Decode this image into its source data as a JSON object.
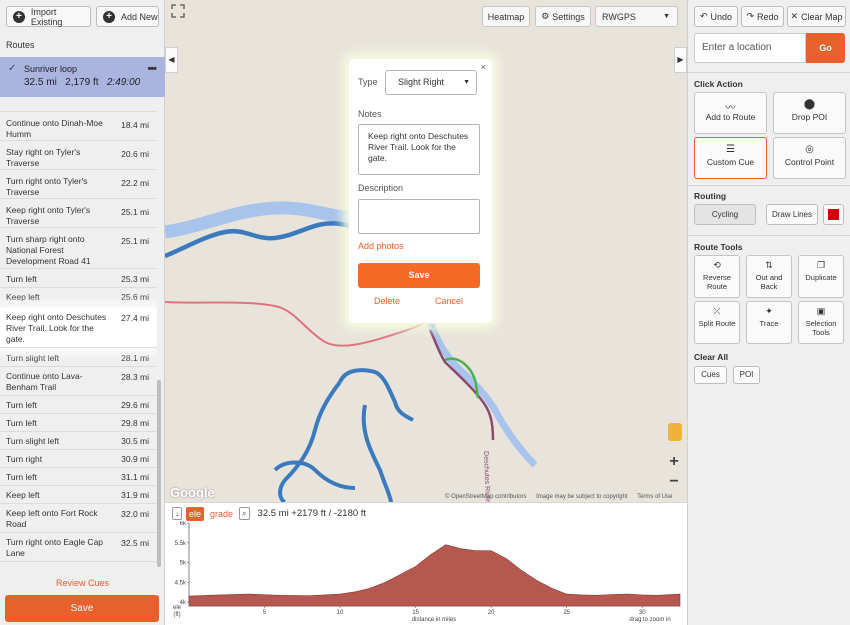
{
  "left_panel": {
    "import_label": "Import Existing",
    "add_new_label": "Add New",
    "routes_heading": "Routes",
    "route": {
      "name": "Sunriver loop",
      "distance": "32.5 mi",
      "elevation": "2,179 ft",
      "time": "2:49:00"
    },
    "cues": [
      {
        "text": "Continue onto Dinah-Moe Humm",
        "distance": "18.4 mi"
      },
      {
        "text": "Stay right on Tyler's Traverse",
        "distance": "20.6 mi"
      },
      {
        "text": "Turn right onto Tyler's Traverse",
        "distance": "22.2 mi"
      },
      {
        "text": "Keep right onto Tyler's Traverse",
        "distance": "25.1 mi"
      },
      {
        "text": "Turn sharp right onto National Forest Development Road 41",
        "distance": "25.1 mi"
      },
      {
        "text": "Turn left",
        "distance": "25.3 mi"
      },
      {
        "text": "Keep left",
        "distance": "25.6 mi"
      },
      {
        "text": "Keep right onto Deschutes River Trail. Look for the gate.",
        "distance": "27.4 mi"
      },
      {
        "text": "Turn slight left",
        "distance": "28.1 mi"
      },
      {
        "text": "Continue onto Lava-Benham Trail",
        "distance": "28.3 mi"
      },
      {
        "text": "Turn left",
        "distance": "29.6 mi"
      },
      {
        "text": "Turn left",
        "distance": "29.8 mi"
      },
      {
        "text": "Turn slight left",
        "distance": "30.5 mi"
      },
      {
        "text": "Turn right",
        "distance": "30.9 mi"
      },
      {
        "text": "Turn left",
        "distance": "31.1 mi"
      },
      {
        "text": "Keep left",
        "distance": "31.9 mi"
      },
      {
        "text": "Keep left onto Fort Rock Road",
        "distance": "32.0 mi"
      },
      {
        "text": "Turn right onto Eagle Cap Lane",
        "distance": "32.5 mi"
      }
    ],
    "review_cues_label": "Review Cues",
    "save_label": "Save"
  },
  "map": {
    "heatmap_label": "Heatmap",
    "settings_label": "Settings",
    "layer_label": "RWGPS",
    "google_label": "Google",
    "attribution": [
      "© OpenStreetMap contributors",
      "Image may be subject to copyright",
      "Terms of Use"
    ],
    "trail_label": "Deschutes River Trail",
    "zoom_in": "+",
    "zoom_out": "−"
  },
  "popup": {
    "type_label": "Type",
    "type_value": "Slight Right",
    "notes_label": "Notes",
    "notes_value": "Keep right onto Deschutes River Trail. Look for the gate.",
    "description_label": "Description",
    "description_value": "",
    "add_photos_label": "Add photos",
    "save_label": "Save",
    "delete_label": "Delete",
    "cancel_label": "Cancel",
    "close_glyph": "×"
  },
  "elevation": {
    "tab_ele": "ele",
    "tab_grade": "grade",
    "summary": "32.5 mi +2179 ft / -2180 ft",
    "y_ticks": [
      "6k",
      "5.5k",
      "5k",
      "4.5k",
      "4k"
    ],
    "y_unit_label": "ele (ft)",
    "x_ticks": [
      "5",
      "10",
      "15",
      "20",
      "25",
      "30"
    ],
    "x_label": "distance in miles",
    "hint": "drag to zoom in",
    "fill_color": "#b5584f"
  },
  "chart_data": {
    "type": "area",
    "xlabel": "distance in miles",
    "ylabel": "ele (ft)",
    "xlim": [
      0,
      32.5
    ],
    "ylim": [
      3900,
      6000
    ],
    "x": [
      0,
      2,
      4,
      6,
      8,
      10,
      11,
      12,
      13,
      14,
      15,
      16,
      17,
      18,
      19,
      20,
      21,
      22,
      23,
      24,
      25,
      26,
      27,
      28,
      29,
      30,
      31,
      32.5
    ],
    "y": [
      4150,
      4180,
      4200,
      4170,
      4160,
      4200,
      4260,
      4350,
      4500,
      4700,
      4900,
      5200,
      5450,
      5350,
      5300,
      5300,
      5100,
      4800,
      4550,
      4350,
      4200,
      4180,
      4170,
      4190,
      4200,
      4180,
      4170,
      4200
    ]
  },
  "right_panel": {
    "undo_label": "Undo",
    "redo_label": "Redo",
    "clear_map_label": "Clear Map",
    "location_placeholder": "Enter a location",
    "go_label": "Go",
    "click_action_heading": "Click Action",
    "add_to_route_label": "Add to Route",
    "drop_poi_label": "Drop POI",
    "custom_cue_label": "Custom Cue",
    "control_point_label": "Control Point",
    "routing_heading": "Routing",
    "cycling_label": "Cycling",
    "draw_lines_label": "Draw Lines",
    "route_color": "#d40000",
    "route_tools_heading": "Route Tools",
    "reverse_route_label": "Reverse Route",
    "out_and_back_label": "Out and Back",
    "duplicate_label": "Duplicate",
    "split_route_label": "Split Route",
    "trace_label": "Trace",
    "selection_tools_label": "Selection Tools",
    "clear_all_heading": "Clear All",
    "cues_label": "Cues",
    "poi_label": "POI"
  },
  "colors": {
    "accent": "#e8602c",
    "route_selected_bg": "#a9b4df",
    "river": "#a8c4ec",
    "trail_blue": "#3b7bbd",
    "route_red": "#e0727d",
    "route_purple": "#8a4a6e",
    "route_green": "#4caf50"
  }
}
